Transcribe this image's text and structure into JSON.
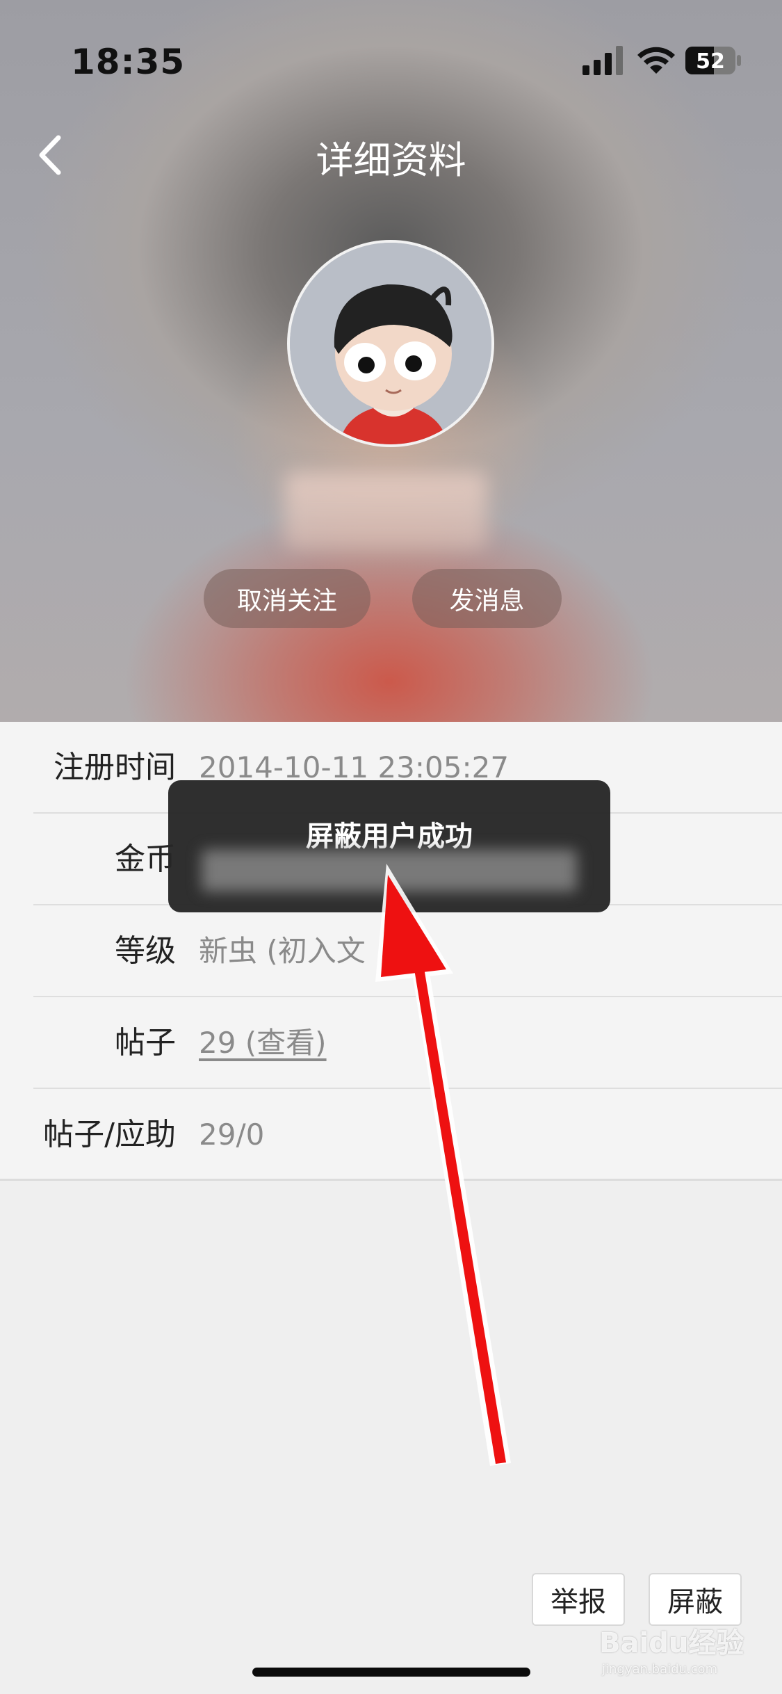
{
  "status_bar": {
    "time": "18:35",
    "battery": "52"
  },
  "nav": {
    "title": "详细资料"
  },
  "profile": {
    "buttons": {
      "unfollow": "取消关注",
      "message": "发消息"
    }
  },
  "info": [
    {
      "label": "注册时间",
      "value": "2014-10-11 23:05:27"
    },
    {
      "label": "金币",
      "value": ""
    },
    {
      "label": "等级",
      "value": "新虫 (初入文"
    },
    {
      "label": "帖子",
      "value": "29 (查看)"
    },
    {
      "label": "帖子/应助",
      "value": "29/0"
    }
  ],
  "actions": {
    "report": "举报",
    "block": "屏蔽"
  },
  "toast": {
    "message": "屏蔽用户成功"
  },
  "watermark": {
    "brand": "Baidu经验",
    "url": "jingyan.baidu.com"
  },
  "colors": {
    "arrow": "#ee1111",
    "toast_bg": "#262626"
  }
}
